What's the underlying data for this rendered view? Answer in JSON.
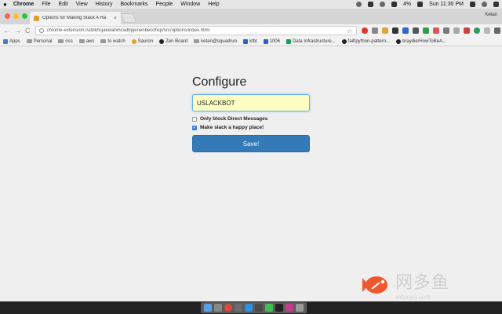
{
  "menubar": {
    "apple": "",
    "app_name": "Chrome",
    "menus": [
      "File",
      "Edit",
      "View",
      "History",
      "Bookmarks",
      "People",
      "Window",
      "Help"
    ],
    "battery": "4%",
    "clock": "Sun 11:30 PM"
  },
  "tab": {
    "title": "Options for Making Slack A Ha",
    "close": "×"
  },
  "user_name": "Ketan",
  "toolbar": {
    "back": "←",
    "forward": "→",
    "reload": "C",
    "url": "chrome-extension://afdkhcjakelahihcadbpjenenbecdhcp/src/options/index.html",
    "star": "☆"
  },
  "bookmarks": [
    {
      "label": "Apps",
      "icon": "apps-icon"
    },
    {
      "label": "Personal",
      "icon": "folder-icon"
    },
    {
      "label": "oss",
      "icon": "folder-icon"
    },
    {
      "label": "aws",
      "icon": "folder-icon"
    },
    {
      "label": "to watch",
      "icon": "folder-icon"
    },
    {
      "label": "Sauron",
      "icon": "sauron-icon"
    },
    {
      "label": "Zen Board",
      "icon": "github-icon"
    },
    {
      "label": "ketan@squadrun",
      "icon": "folder-icon"
    },
    {
      "label": "ktbt",
      "icon": "bookmark-icon"
    },
    {
      "label": "1006",
      "icon": "bookmark-icon"
    },
    {
      "label": "Data Infrastructure...",
      "icon": "bookmark-icon"
    },
    {
      "label": "faif/python-pattern...",
      "icon": "github-icon"
    },
    {
      "label": "braydie/HowToBeA...",
      "icon": "github-icon"
    }
  ],
  "page": {
    "heading": "Configure",
    "input_value": "USLACKBOT",
    "checkbox_block_dm": "Only block Direct Messages",
    "checkbox_happy": "Make slack a happy place!",
    "save_label": "Save!"
  },
  "watermark": {
    "cn_text": "网多鱼",
    "url_text": "wduoyu.com"
  },
  "colors": {
    "accent": "#337ab7",
    "input_bg": "#fdffc2"
  }
}
